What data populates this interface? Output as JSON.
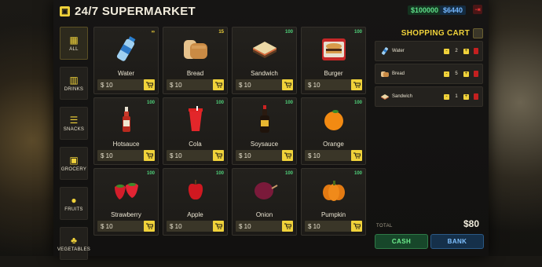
{
  "header": {
    "title": "24/7 SUPERMARKET",
    "cash": "$100000",
    "bank": "$6440"
  },
  "categories": [
    {
      "label": "ALL",
      "icon": "grid-icon",
      "active": true
    },
    {
      "label": "DRINKS",
      "icon": "cup-icon",
      "active": false
    },
    {
      "label": "SNACKS",
      "icon": "burger-icon",
      "active": false
    },
    {
      "label": "GROCERY",
      "icon": "box-icon",
      "active": false
    },
    {
      "label": "FRUITS",
      "icon": "apple-icon",
      "active": false
    },
    {
      "label": "VEGETABLES",
      "icon": "leaf-icon",
      "active": false
    }
  ],
  "products": [
    {
      "name": "Water",
      "price": "$ 10",
      "stock": "∞",
      "icon": "water-bottle-icon"
    },
    {
      "name": "Bread",
      "price": "$ 10",
      "stock": "15",
      "icon": "bread-icon"
    },
    {
      "name": "Sandwich",
      "price": "$ 10",
      "stock": "100",
      "icon": "sandwich-icon"
    },
    {
      "name": "Burger",
      "price": "$ 10",
      "stock": "100",
      "icon": "burger-icon"
    },
    {
      "name": "Hotsauce",
      "price": "$ 10",
      "stock": "100",
      "icon": "hotsauce-icon"
    },
    {
      "name": "Cola",
      "price": "$ 10",
      "stock": "100",
      "icon": "cola-cup-icon"
    },
    {
      "name": "Soysauce",
      "price": "$ 10",
      "stock": "100",
      "icon": "soysauce-icon"
    },
    {
      "name": "Orange",
      "price": "$ 10",
      "stock": "100",
      "icon": "orange-icon"
    },
    {
      "name": "Strawberry",
      "price": "$ 10",
      "stock": "100",
      "icon": "strawberry-icon"
    },
    {
      "name": "Apple",
      "price": "$ 10",
      "stock": "100",
      "icon": "apple-icon"
    },
    {
      "name": "Onion",
      "price": "$ 10",
      "stock": "100",
      "icon": "onion-icon"
    },
    {
      "name": "Pumpkin",
      "price": "$ 10",
      "stock": "100",
      "icon": "pumpkin-icon"
    }
  ],
  "cart": {
    "title": "SHOPPING CART",
    "items": [
      {
        "name": "Water",
        "qty": "2",
        "icon": "water-bottle-icon"
      },
      {
        "name": "Bread",
        "qty": "5",
        "icon": "bread-icon"
      },
      {
        "name": "Sandwich",
        "qty": "1",
        "icon": "sandwich-icon"
      }
    ],
    "minus": "-",
    "plus": "+",
    "total_label": "TOTAL",
    "total": "$80",
    "cash_label": "CASH",
    "bank_label": "BANK"
  },
  "colors": {
    "accent": "#f0d23a",
    "stock": "#4fd17a",
    "cash": "#5fe08a",
    "bank": "#73b6ff",
    "danger": "#c42020"
  }
}
